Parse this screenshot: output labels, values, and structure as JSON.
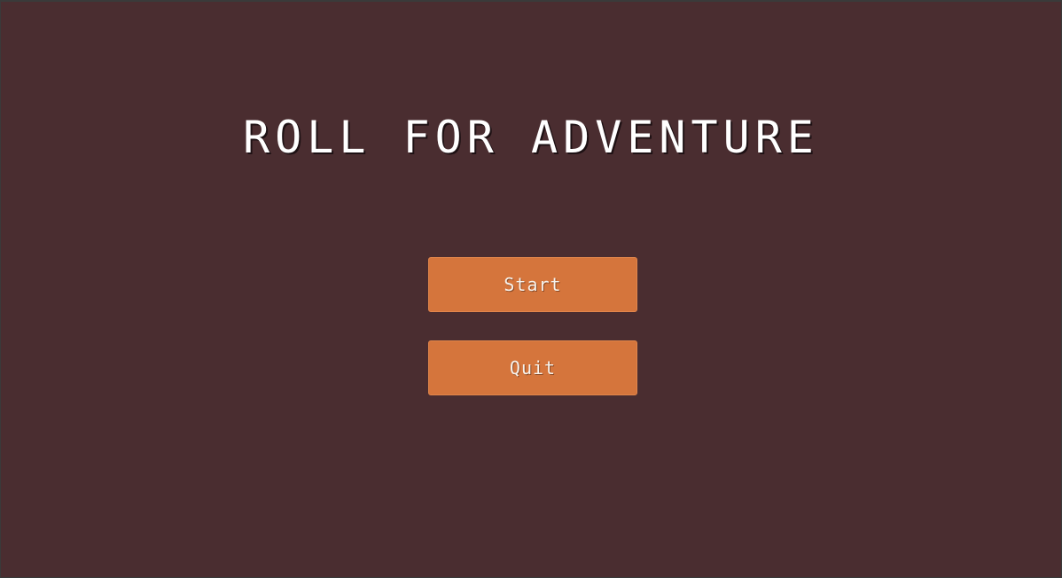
{
  "game": {
    "title": "ROLL FOR ADVENTURE"
  },
  "menu": {
    "start_label": "Start",
    "quit_label": "Quit"
  },
  "colors": {
    "background": "#4a2d30",
    "button": "#d5753c",
    "text": "#ffffff"
  }
}
